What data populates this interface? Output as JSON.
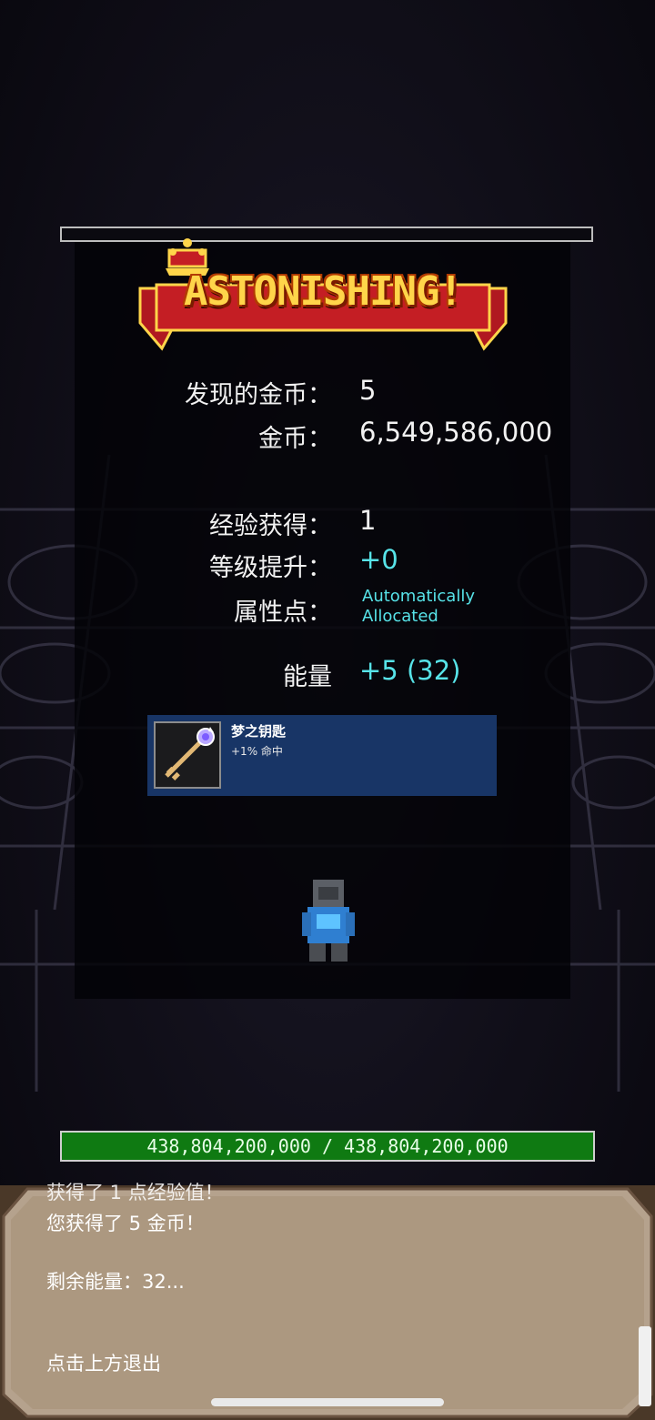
{
  "banner": {
    "text": "ASTONISHING!"
  },
  "stats": {
    "gold_found_label": "发现的金币：",
    "gold_found_value": "5",
    "gold_label": "金币：",
    "gold_value": "6,549,586,000",
    "exp_label": "经验获得：",
    "exp_value": "1",
    "level_label": "等级提升：",
    "level_value": "+0",
    "attr_label": "属性点：",
    "attr_value_line1": "Automatically",
    "attr_value_line2": "Allocated",
    "energy_label": "能量",
    "energy_value": "+5 (32)"
  },
  "item": {
    "name": "梦之钥匙",
    "desc": "+1% 命中",
    "icon": "key-icon"
  },
  "hp": {
    "text": "438,804,200,000 / 438,804,200,000",
    "current": 438804200000,
    "max": 438804200000
  },
  "dialog": {
    "line_partial": "获得了 1 点经验值！",
    "line1": "您获得了 5 金币！",
    "line2": "剩余能量：32...",
    "line3": "点击上方退出"
  },
  "colors": {
    "accent_cyan": "#57e3e8",
    "item_box": "#183566",
    "hp_green": "#0f7a12"
  }
}
